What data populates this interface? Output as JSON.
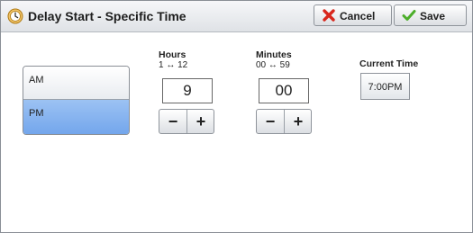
{
  "dialog": {
    "title": "Delay Start - Specific Time",
    "title_icon": "clock-icon",
    "cancel_label": "Cancel",
    "cancel_icon": "red-x-icon",
    "save_label": "Save",
    "save_icon": "green-check-icon"
  },
  "period": {
    "options": [
      "AM",
      "PM"
    ],
    "selected": "PM"
  },
  "hours": {
    "label": "Hours",
    "range": "1 ↔ 12",
    "value": "9",
    "minus": "−",
    "plus": "+"
  },
  "minutes": {
    "label": "Minutes",
    "range": "00 ↔ 59",
    "value": "00",
    "minus": "−",
    "plus": "+"
  },
  "current_time": {
    "label": "Current Time",
    "value": "7:00PM"
  },
  "colors": {
    "selected_bg": "#7fb0ee",
    "cancel_icon": "#d8261c",
    "save_icon": "#4cae2a"
  }
}
